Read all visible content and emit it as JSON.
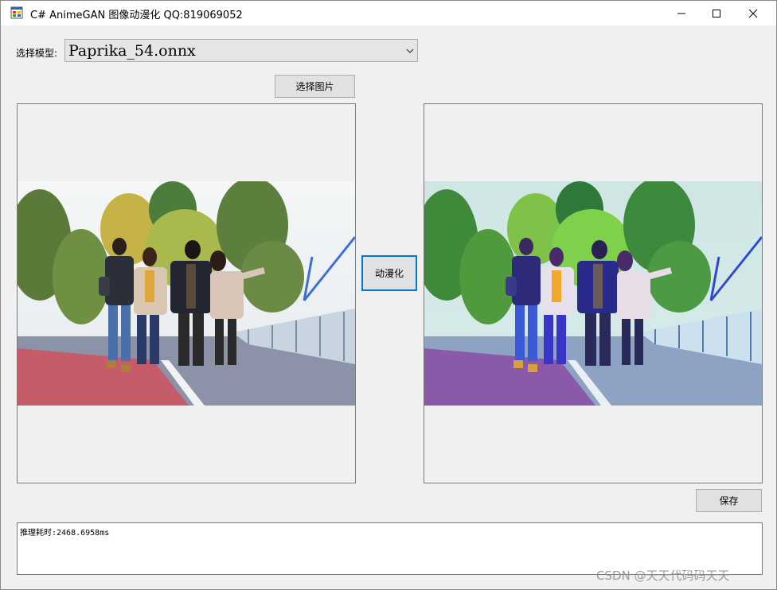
{
  "window": {
    "title": "C# AnimeGAN 图像动漫化 QQ:819069052",
    "icon": "app-form-icon",
    "controls": [
      "minimize-icon",
      "maximize-icon",
      "close-icon"
    ]
  },
  "model": {
    "label": "选择模型:",
    "selected": "Paprika_54.onnx"
  },
  "buttons": {
    "select_image": "选择图片",
    "animefy": "动漫化",
    "save": "保存"
  },
  "images": {
    "source": "original-photo",
    "result": "anime-styled-photo"
  },
  "log": {
    "text": "推理耗时:2468.6958ms"
  },
  "watermark": "CSDN @天天代码码天天",
  "colors": {
    "focus_border": "#0078d7",
    "button_bg": "#e1e1e1",
    "window_bg": "#f0f0f0"
  }
}
